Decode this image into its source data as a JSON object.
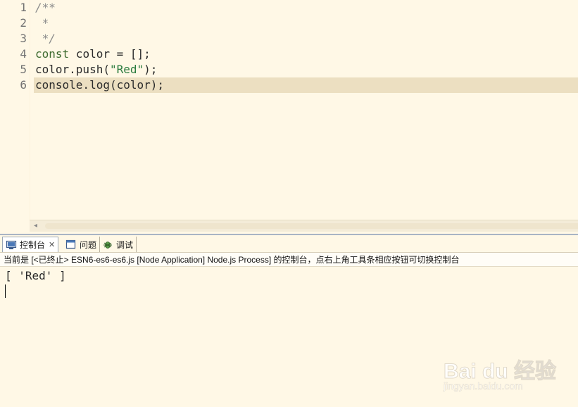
{
  "editor": {
    "line_numbers": [
      "1",
      "2",
      "3",
      "4",
      "5",
      "6"
    ],
    "lines": [
      {
        "tokens": [
          {
            "t": "/**",
            "k": "comment"
          }
        ]
      },
      {
        "tokens": [
          {
            "t": " *",
            "k": "comment"
          }
        ]
      },
      {
        "tokens": [
          {
            "t": " */",
            "k": "comment"
          }
        ]
      },
      {
        "tokens": [
          {
            "t": "const",
            "k": "kw"
          },
          {
            "t": " color = [];",
            "k": "plain"
          }
        ]
      },
      {
        "tokens": [
          {
            "t": "color.push(",
            "k": "plain"
          },
          {
            "t": "\"Red\"",
            "k": "str"
          },
          {
            "t": ");",
            "k": "plain"
          }
        ]
      },
      {
        "tokens": [
          {
            "t": "console.log(color);",
            "k": "plain"
          }
        ]
      }
    ],
    "current_line": 6,
    "scroll_left_arrow": "◂"
  },
  "console_view": {
    "tabs": [
      {
        "label": "控制台",
        "icon": "console-icon",
        "active": true,
        "close": "✕"
      },
      {
        "label": "问题",
        "icon": "problems-icon",
        "active": false
      },
      {
        "label": "调试",
        "icon": "debug-icon",
        "active": false
      }
    ],
    "description": "当前是 [<已终止> ESN6-es6-es6.js [Node Application] Node.js Process] 的控制台，点右上角工具条相应按钮可切换控制台",
    "output": "[ 'Red' ]"
  },
  "watermark": {
    "text": "Bai du 经验",
    "sub": "jingyan.baidu.com"
  },
  "colors": {
    "background": "#fff8e6",
    "current_line": "#ecdfc1",
    "keyword": "#3d6a2f",
    "string": "#2a7b3e",
    "comment": "#8c8c8c"
  }
}
